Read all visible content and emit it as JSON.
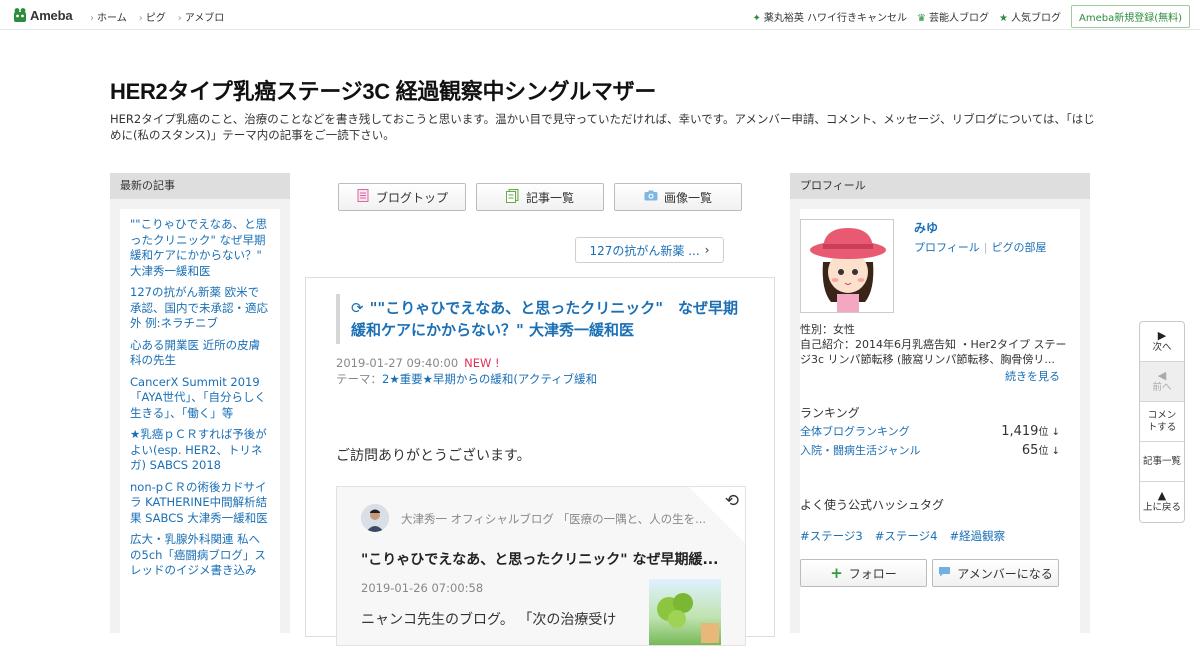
{
  "global_header": {
    "logo_text": "Ameba",
    "nav": [
      "ホーム",
      "ピグ",
      "アメブロ"
    ],
    "right_links": [
      {
        "icon": "sparkle-icon",
        "label": "薬丸裕英 ハワイ行きキャンセル"
      },
      {
        "icon": "crown-icon",
        "label": "芸能人ブログ"
      },
      {
        "icon": "star-icon",
        "label": "人気ブログ"
      }
    ],
    "signup_label": "Ameba新規登録(無料)"
  },
  "blog": {
    "title": "HER2タイプ乳癌ステージ3C 経過観察中シングルマザー",
    "description": "HER2タイプ乳癌のこと、治療のことなどを書き残しておこうと思います。温かい目で見守っていただければ、幸いです。アメンバー申請、コメント、メッセージ、リブログについては、「はじめに(私のスタンス)」テーマ内の記事をご一読下さい。"
  },
  "left_sidebar": {
    "heading": "最新の記事",
    "items": [
      "\"\"こりゃひでえなあ、と思ったクリニック\" なぜ早期緩和ケアにかからない？\" 大津秀一緩和医",
      "127の抗がん新薬 欧米で承認、国内で未承認・適応外 例:ネラチニブ",
      "心ある開業医 近所の皮膚科の先生",
      "CancerX Summit 2019 「AYA世代」、「自分らしく生きる」、「働く」等",
      "★乳癌ｐＣＲすれば予後がよい(esp. HER2、トリネガ) SABCS 2018",
      "non-pＣＲの術後カドサイラ KATHERINE中間解析結果 SABCS 大津秀一緩和医",
      "広大・乳腺外科関連 私への5ch「癌闘病ブログ」スレッドのイジメ書き込み"
    ]
  },
  "center": {
    "nav_buttons": [
      {
        "icon": "document-icon",
        "label": "ブログトップ"
      },
      {
        "icon": "articles-icon",
        "label": "記事一覧"
      },
      {
        "icon": "camera-icon",
        "label": "画像一覧"
      }
    ],
    "next_article_label": "127の抗がん新薬 ...",
    "entry": {
      "title": "\"\"こりゃひでえなあ、と思ったクリニック\"　なぜ早期緩和ケアにかからない？\" 大津秀一緩和医",
      "date": "2019-01-27 09:40:00",
      "new_badge": "NEW !",
      "theme_label": "テーマ：",
      "theme": "2★重要★早期からの緩和(アクティブ緩和",
      "body_text": "ご訪問ありがとうございます。",
      "reblog": {
        "author": "大津秀一 オフィシャルブログ 「医療の一隅と、人の生を...",
        "title": "\"こりゃひでえなあ、と思ったクリニック\" なぜ早期緩...",
        "date": "2019-01-26 07:00:58",
        "excerpt": "ニャンコ先生のブログ。 「次の治療受け"
      }
    }
  },
  "right_sidebar": {
    "heading": "プロフィール",
    "name": "みゆ",
    "links": [
      "プロフィール",
      "ピグの部屋"
    ],
    "gender": "性別：女性",
    "intro": "自己紹介：2014年6月乳癌告知 ・Her2タイプ ステージ3c リンパ節転移 (腋窩リンパ節転移、胸骨傍リ...",
    "read_more": "続きを見る",
    "ranking_heading": "ランキング",
    "rankings": [
      {
        "label": "全体ブログランキング",
        "value": "1,419",
        "unit": "位"
      },
      {
        "label": "入院・闘病生活ジャンル",
        "value": "65",
        "unit": "位"
      }
    ],
    "hashtag_heading": "よく使う公式ハッシュタグ",
    "hashtags": [
      "#ステージ3",
      "#ステージ4",
      "#経過観察"
    ],
    "follow_label": "フォロー",
    "member_label": "アメンバーになる"
  },
  "float_nav": [
    {
      "icon": "next-arrow-icon",
      "label": "次へ"
    },
    {
      "icon": "prev-arrow-icon",
      "label": "前へ"
    },
    {
      "label": "コメントする"
    },
    {
      "label": "記事一覧"
    },
    {
      "icon": "up-arrow-icon",
      "label": "上に戻る"
    }
  ]
}
